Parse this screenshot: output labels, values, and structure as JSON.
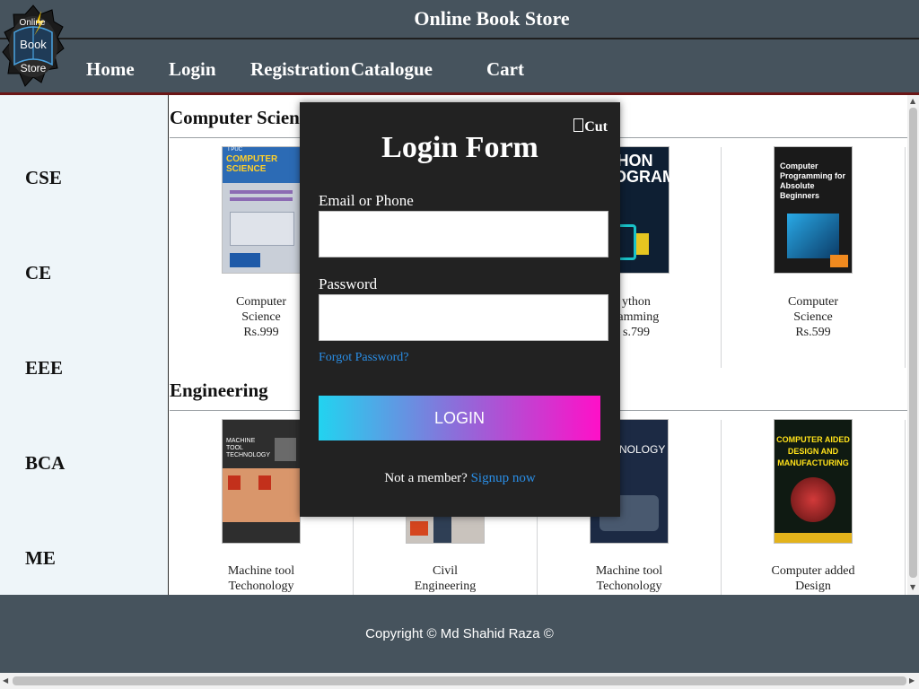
{
  "header": {
    "title": "Online Book Store",
    "logo_text": [
      "Online",
      "Book",
      "Store"
    ],
    "nav": [
      "Home",
      "Login",
      "Registration",
      "Catalogue",
      "Cart"
    ]
  },
  "sidebar": {
    "items": [
      "CSE",
      "CE",
      "EEE",
      "BCA",
      "ME"
    ]
  },
  "sections": [
    {
      "title": "Computer Science",
      "books": [
        {
          "cover_title": "COMPUTER SCIENCE",
          "cover_top": "I PUC",
          "name_lines": [
            "Computer",
            "Science"
          ],
          "price": "Rs.999"
        },
        {
          "name_lines": [],
          "price": ""
        },
        {
          "cover_title": "THON PROGRAMMING",
          "name_lines": [
            "ython",
            "ramming"
          ],
          "price": "s.799"
        },
        {
          "cover_title": "Computer Programming for Absolute Beginners",
          "name_lines": [
            "Computer",
            "Science"
          ],
          "price": "Rs.599"
        }
      ]
    },
    {
      "title": "Engineering",
      "books": [
        {
          "cover_title": "MACHINE TOOL TECHNOLOGY",
          "name_lines": [
            "Machine tool",
            "Techonology"
          ]
        },
        {
          "name_lines": [
            "Civil",
            "Engineering"
          ]
        },
        {
          "cover_title": "HINE NOLOGY",
          "name_lines": [
            "Machine tool",
            "Techonology"
          ]
        },
        {
          "cover_title": "COMPUTER AIDED DESIGN AND MANUFACTURING",
          "name_lines": [
            "Computer added",
            "Design"
          ]
        }
      ]
    }
  ],
  "modal": {
    "close_label": "Cut",
    "title": "Login Form",
    "email_label": "Email or Phone",
    "email_value": "",
    "password_label": "Password",
    "password_value": "",
    "forgot_label": "Forgot Password?",
    "login_button": "LOGIN",
    "signup_prompt": "Not a member?",
    "signup_link": "Signup now"
  },
  "footer": {
    "copyright": "Copyright © Md Shahid Raza ©"
  },
  "colors": {
    "header_bg": "#46535d",
    "accent_link": "#2a8ee6",
    "modal_bg": "#222222",
    "gradient_start": "#22d3f0",
    "gradient_end": "#ff10c8"
  }
}
